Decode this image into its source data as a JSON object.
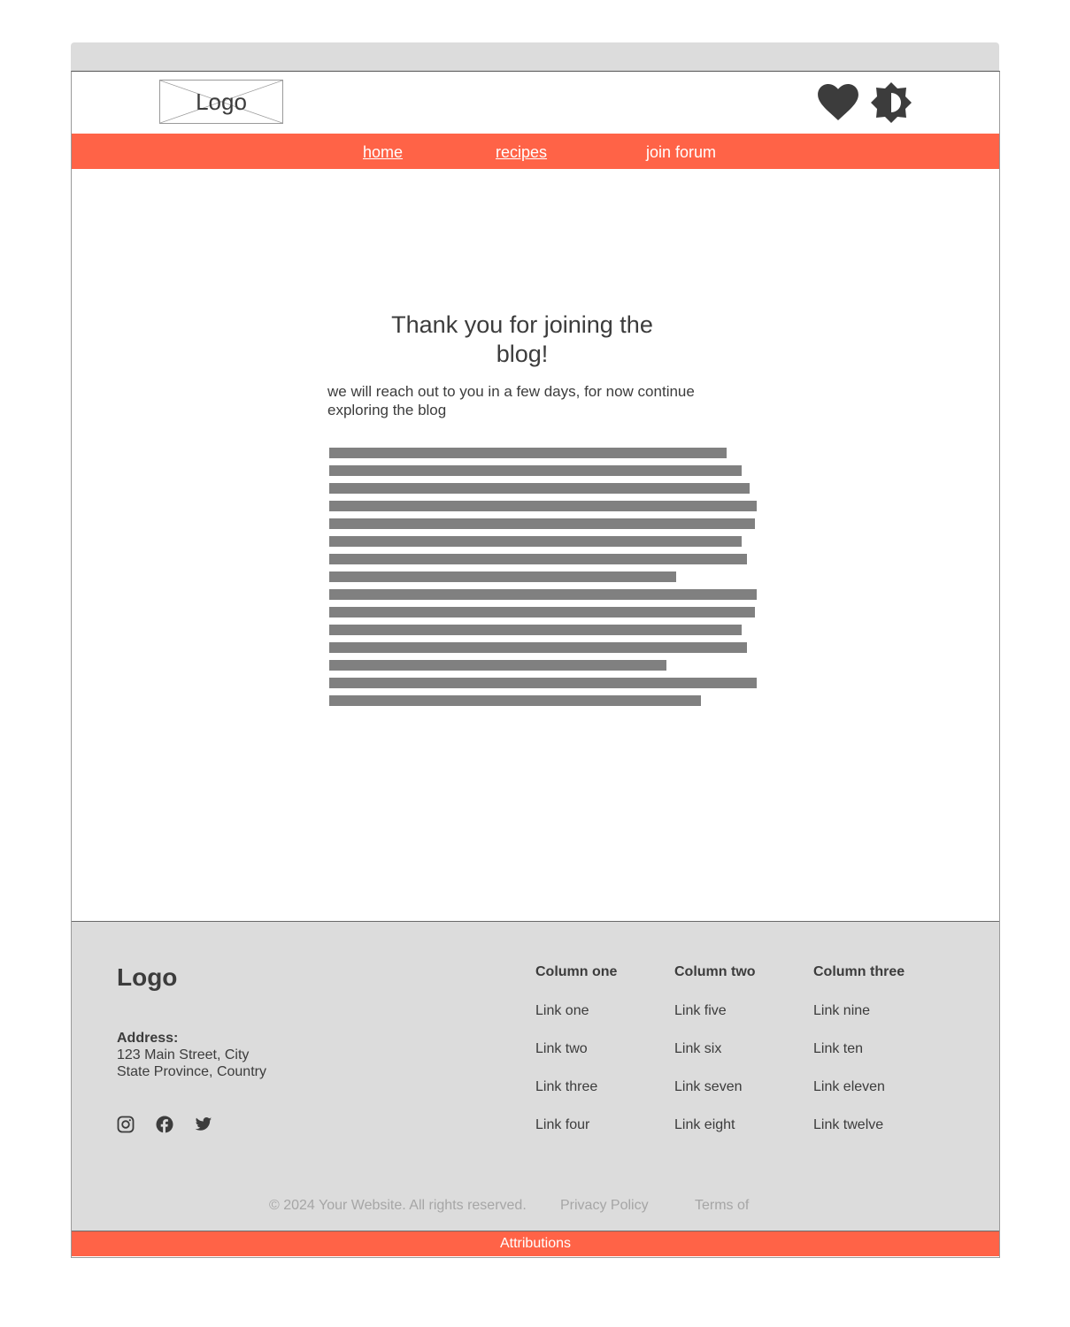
{
  "header": {
    "logo": "Logo",
    "icons": [
      "heart-icon",
      "brightness-icon"
    ]
  },
  "nav": {
    "items": [
      {
        "label": "home"
      },
      {
        "label": "recipes"
      },
      {
        "label": "join forum"
      }
    ]
  },
  "main": {
    "title": "Thank you for joining the blog!",
    "subtitle": "we will reach out to you in a few days, for now continue exploring the blog"
  },
  "footer": {
    "logo": "Logo",
    "address_label": "Address:",
    "address_line1": "123 Main Street, City",
    "address_line2": "State Province, Country",
    "social_icons": [
      "instagram-icon",
      "facebook-icon",
      "twitter-icon"
    ],
    "columns": [
      {
        "title": "Column one",
        "links": [
          "Link one",
          "Link two",
          "Link three",
          "Link four"
        ]
      },
      {
        "title": "Column two",
        "links": [
          "Link five",
          "Link six",
          "Link seven",
          "Link eight"
        ]
      },
      {
        "title": "Column three",
        "links": [
          "Link nine",
          "Link ten",
          "Link eleven",
          "Link twelve"
        ]
      }
    ],
    "copyright": "© 2024 Your Website. All rights reserved.",
    "privacy": "Privacy Policy",
    "terms": "Terms of",
    "attributions": "Attributions"
  },
  "colors": {
    "accent": "#ff6347",
    "text": "#3c3c3c",
    "footer_bg": "#dcdcdc",
    "placeholder": "#808080"
  }
}
